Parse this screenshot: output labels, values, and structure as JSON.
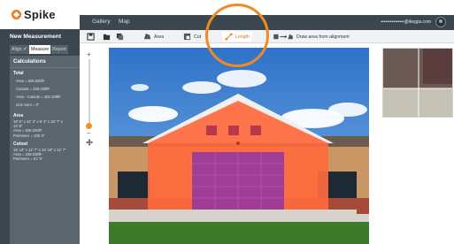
{
  "app": {
    "logo_text": "Spike"
  },
  "nav": {
    "gallery": "Gallery",
    "map": "Map"
  },
  "user": {
    "email": "•••••••••••••••@ikegps.com"
  },
  "sidebar": {
    "panel_title": "New Measurement",
    "tabs": [
      {
        "label": "Align",
        "state": "done"
      },
      {
        "label": "Measure",
        "state": "active"
      },
      {
        "label": "Report",
        "state": "inactive"
      }
    ],
    "calculations": {
      "title": "Calculations",
      "total": {
        "heading": "Total",
        "items": [
          "Area = 626.025ft²",
          "Cutouts = 236.028ft²",
          "Area - Cutouts = 402.108ft²",
          "Line Sum = 0\""
        ]
      },
      "area": {
        "heading": "Area",
        "lines": [
          "19' 6\" x 13' 4\" x 6' 4\" x 33' 7\" x",
          "14' 8\"",
          "Area = 626.025ft²",
          "Perimeter = 105' 5\""
        ]
      },
      "cutout": {
        "heading": "Cutout",
        "lines": [
          "15' 10\" x 12' 7\" x 18' 10\" x 12' 7\"",
          "Area = 236.028ft²",
          "Perimeter = 61' 9\""
        ]
      }
    }
  },
  "toolbar": {
    "items": [
      {
        "label": "",
        "icon": "save-icon"
      },
      {
        "label": "",
        "icon": "folder-icon"
      },
      {
        "label": "",
        "icon": "copy-icon"
      },
      {
        "label": "Area",
        "icon": "area-icon"
      },
      {
        "label": "Cut",
        "icon": "cutout-icon"
      },
      {
        "label": "Length",
        "icon": "length-icon",
        "active": true
      },
      {
        "label": "Draw area from alignment",
        "icon": "align-draw-icon"
      }
    ]
  },
  "zoom": {
    "in": "+",
    "out": "−",
    "level_fraction": 0.95
  },
  "colors": {
    "accent": "#f08a25",
    "sidebar_bg": "#3b4650",
    "area_overlay": "#ff6a3d",
    "cutout_overlay": "#9b3a9b"
  }
}
